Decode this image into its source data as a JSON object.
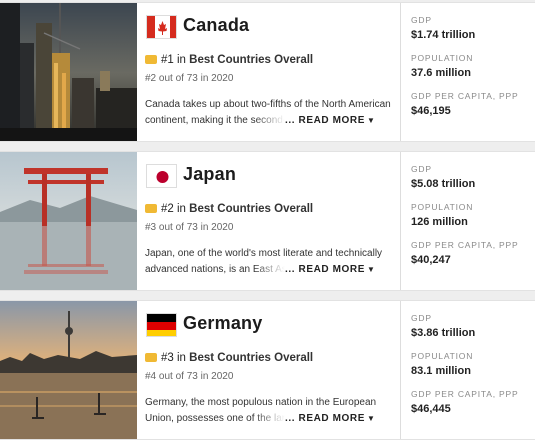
{
  "countries": [
    {
      "name": "Canada",
      "flag_icon": "canada-flag-icon",
      "photo": "city-skyline-dusk-photo",
      "rank": "#1 in",
      "rank_category": "Best Countries Overall",
      "sub_rank": "#2 out of 73 in 2020",
      "desc_line1": "Canada takes up about two-fifths of the North American",
      "desc_line2": "continent, making it the second-la",
      "read_more": "... READ MORE",
      "stats": [
        {
          "label": "GDP",
          "value": "$1.74 trillion"
        },
        {
          "label": "POPULATION",
          "value": "37.6 million"
        },
        {
          "label": "GDP PER CAPITA, PPP",
          "value": "$46,195"
        }
      ]
    },
    {
      "name": "Japan",
      "flag_icon": "japan-flag-icon",
      "photo": "torii-gate-water-photo",
      "rank": "#2 in",
      "rank_category": "Best Countries Overall",
      "sub_rank": "#3 out of 73 in 2020",
      "desc_line1": "Japan, one of the world's most literate and technically",
      "desc_line2": "advanced nations, is an East Asian",
      "read_more": "... READ MORE",
      "stats": [
        {
          "label": "GDP",
          "value": "$5.08 trillion"
        },
        {
          "label": "POPULATION",
          "value": "126 million"
        },
        {
          "label": "GDP PER CAPITA, PPP",
          "value": "$40,247"
        }
      ]
    },
    {
      "name": "Germany",
      "flag_icon": "germany-flag-icon",
      "photo": "river-tv-tower-sunset-photo",
      "rank": "#3 in",
      "rank_category": "Best Countries Overall",
      "sub_rank": "#4 out of 73 in 2020",
      "desc_line1": "Germany, the most populous nation in the European",
      "desc_line2": "Union, possesses one of the large",
      "read_more": "... READ MORE",
      "stats": [
        {
          "label": "GDP",
          "value": "$3.86 trillion"
        },
        {
          "label": "POPULATION",
          "value": "83.1 million"
        },
        {
          "label": "GDP PER CAPITA, PPP",
          "value": "$46,445"
        }
      ]
    }
  ],
  "colors": {
    "medal": "#f0b934",
    "canada_red": "#d52b1e",
    "japan_red": "#bc002d",
    "germany_black": "#000000",
    "germany_red": "#dd0000",
    "germany_gold": "#ffce00"
  },
  "icons": {
    "medal": "medal-icon",
    "chevron": "chevron-down-icon"
  }
}
